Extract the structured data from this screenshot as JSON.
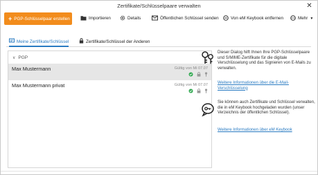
{
  "window": {
    "title": "Zertifikate/Schlüsselpaare verwalten",
    "close_glyph": "✕"
  },
  "toolbar": {
    "create_label": "PGP-Schlüsselpaar erstellen",
    "import_label": "Importieren",
    "details_label": "Details",
    "send_public_label": "Öffentlichen Schlüssel senden",
    "remove_keybook_label": "Von eM Keybook entfernen",
    "more_label": "Mehr",
    "accent_color": "#f28c1c"
  },
  "tabs": [
    {
      "label": "Meine Zertifikate/Schlüssel",
      "icon": "certificate-icon",
      "active": true
    },
    {
      "label": "Zertifikate/Schlüssel der Anderen",
      "icon": "lock-icon",
      "active": false
    }
  ],
  "list": {
    "group_label": "PGP",
    "items": [
      {
        "name": "Max Mustermann",
        "validity": "Gültig von Mi 07.07",
        "selected": true
      },
      {
        "name": "Max Mustermann privat",
        "validity": "Gültig von Mi 07.07",
        "selected": false
      }
    ]
  },
  "info": {
    "text1": "Dieser Dialog hilft Ihnen Ihre PGP-Schlüsselpaare und S/MIME-Zertifikate für die digitale Verschlüsselung und das Signieren von E-Mails zu verwalten.",
    "link1": "Weitere Informationen über die E-Mail-Verschlüsselung",
    "text2": "Sie können auch Zertifikate und Schlüssel verwalten, die in eM Keybook hochgeladen wurden (unser Verzeichnis der öffentlichen Schlüssel).",
    "link2": "Weitere Informationen über eM Keybook",
    "link_color": "#2a7bc2"
  }
}
